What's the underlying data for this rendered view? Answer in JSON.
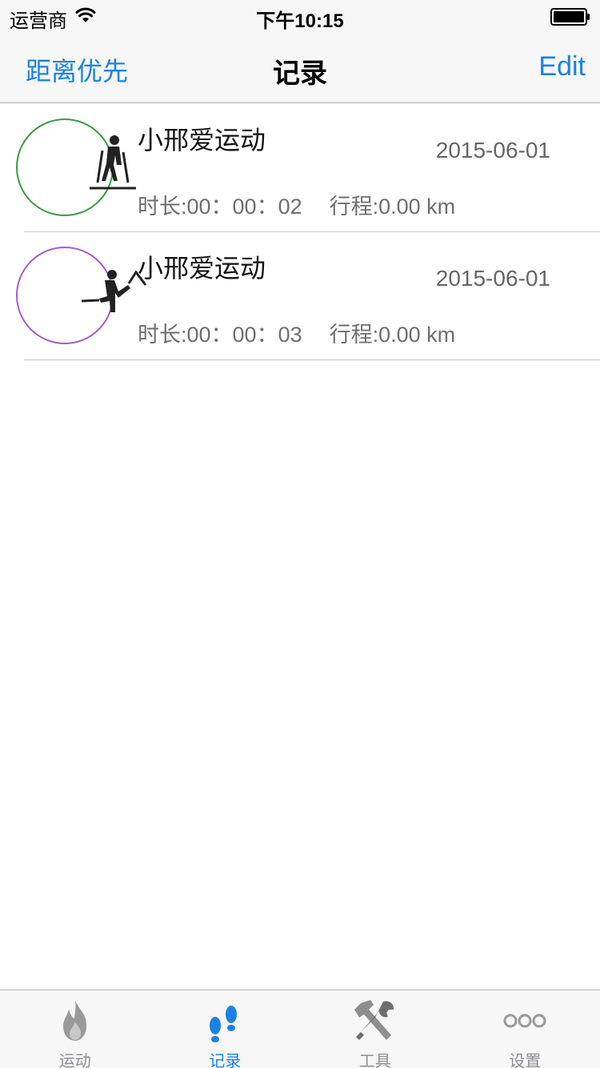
{
  "status_bar": {
    "carrier": "运营商",
    "time": "下午10:15"
  },
  "nav": {
    "left": "距离优先",
    "title": "记录",
    "right": "Edit",
    "accent_color": "#1a82e2"
  },
  "records": [
    {
      "title": "小邢爱运动",
      "date": "2015-06-01",
      "duration": "时长:00：00：02",
      "distance": "行程:0.00 km",
      "ring_color": "#3a9a44",
      "icon": "cross-country-skiing-icon"
    },
    {
      "title": "小邢爱运动",
      "date": "2015-06-01",
      "duration": "时长:00：00：03",
      "distance": "行程:0.00 km",
      "ring_color": "#a45ad6",
      "icon": "climbing-icon"
    }
  ],
  "tabs": [
    {
      "label": "运动",
      "icon": "flame-icon",
      "active": false
    },
    {
      "label": "记录",
      "icon": "footprints-icon",
      "active": true
    },
    {
      "label": "工具",
      "icon": "tools-icon",
      "active": false
    },
    {
      "label": "设置",
      "icon": "more-icon",
      "active": false
    }
  ]
}
